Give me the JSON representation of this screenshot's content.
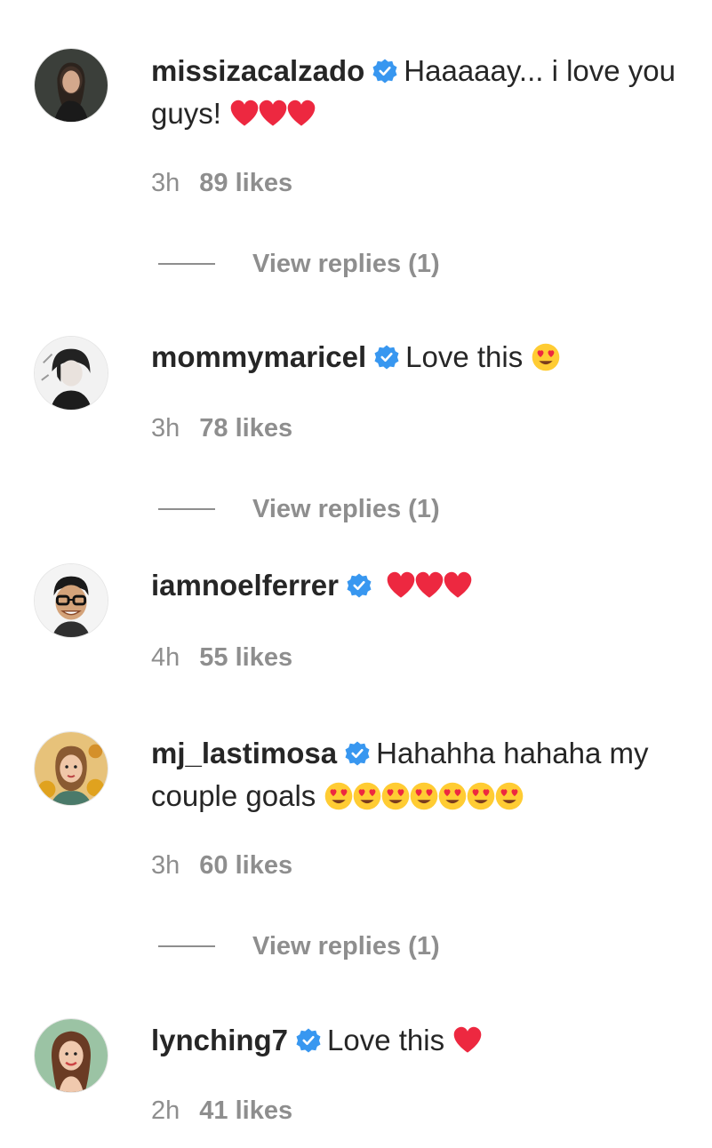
{
  "comments": [
    {
      "username": "missizacalzado",
      "text": "Haaaaay... i love you guys!",
      "emojis": [
        "red-heart",
        "red-heart",
        "red-heart"
      ],
      "time": "3h",
      "likes": "89 likes",
      "view_replies": "View replies (1)"
    },
    {
      "username": "mommymaricel",
      "text": "Love this",
      "emojis": [
        "heart-eyes"
      ],
      "time": "3h",
      "likes": "78 likes",
      "view_replies": "View replies (1)"
    },
    {
      "username": "iamnoelferrer",
      "text": "",
      "emojis": [
        "red-heart",
        "red-heart",
        "red-heart"
      ],
      "time": "4h",
      "likes": "55 likes"
    },
    {
      "username": "mj_lastimosa",
      "text": "Hahahha hahaha my couple goals",
      "emojis": [
        "heart-eyes",
        "heart-eyes",
        "heart-eyes",
        "heart-eyes",
        "heart-eyes",
        "heart-eyes",
        "heart-eyes"
      ],
      "time": "3h",
      "likes": "60 likes",
      "view_replies": "View replies (1)"
    },
    {
      "username": "lynching7",
      "text": "Love this",
      "emojis": [
        "red-heart"
      ],
      "time": "2h",
      "likes": "41 likes"
    }
  ],
  "icons": {
    "verified": "verified-badge-icon",
    "heart": "red-heart-emoji",
    "heart_eyes": "heart-eyes-emoji"
  },
  "colors": {
    "text": "#262626",
    "secondary": "#8e8e8e",
    "verified": "#3897f0",
    "heart": "#ed2840"
  }
}
